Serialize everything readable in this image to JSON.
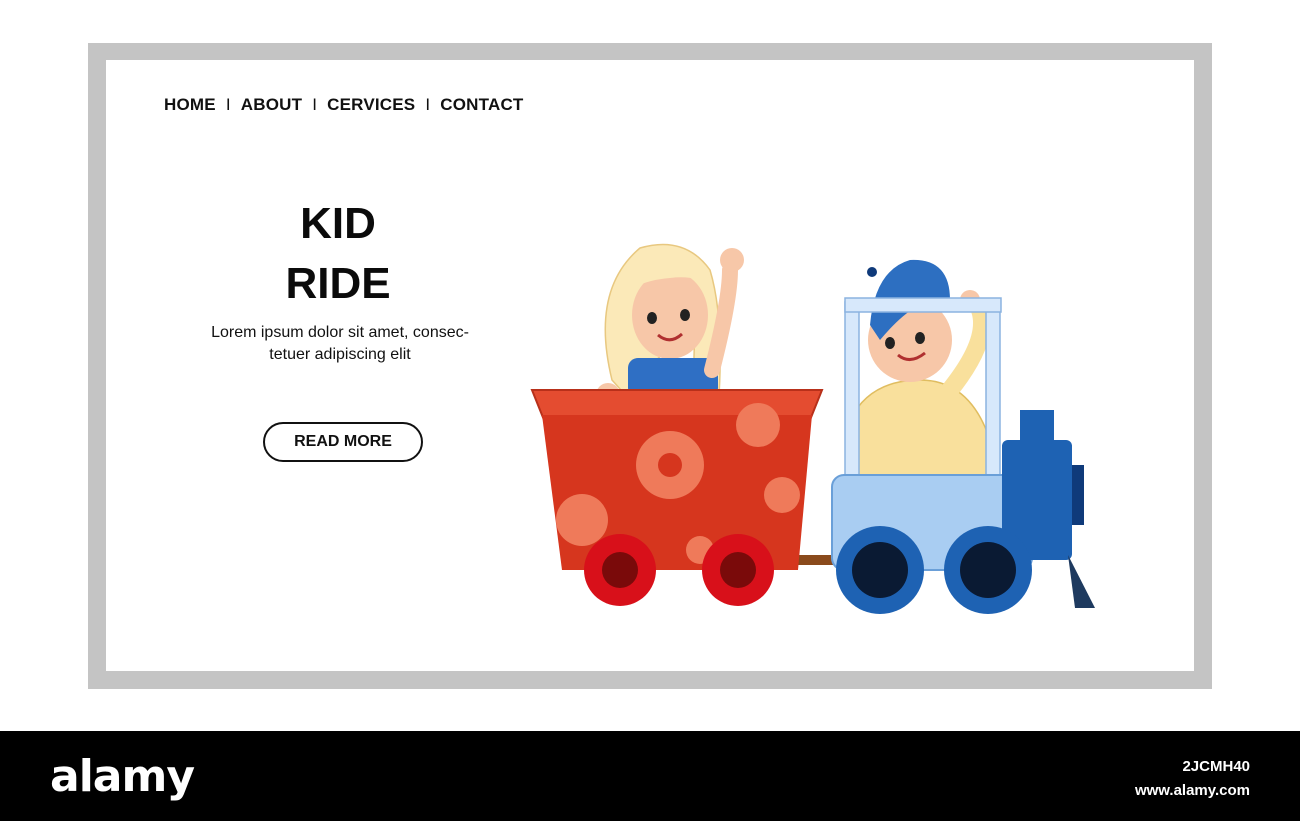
{
  "nav": {
    "items": [
      "HOME",
      "ABOUT",
      "CERVICES",
      "CONTACT"
    ],
    "separator": "I"
  },
  "hero": {
    "title_line1": "KID",
    "title_line2": "RIDE",
    "subtitle_line1": "Lorem ipsum dolor sit amet, consec-",
    "subtitle_line2": "tetuer adipiscing elit",
    "button_label": "READ MORE"
  },
  "footer": {
    "logo": "alamy",
    "image_id": "2JCMH40",
    "site": "www.alamy.com"
  },
  "colors": {
    "wagon": "#d6361e",
    "wagon_flower": "#ef7a5a",
    "wheel_red": "#d8101a",
    "engine_light": "#a9cdf2",
    "engine_dark": "#1e62b3",
    "shirt": "#f9e09c",
    "hat": "#2d6fc1",
    "hair": "#fbe9b8"
  }
}
